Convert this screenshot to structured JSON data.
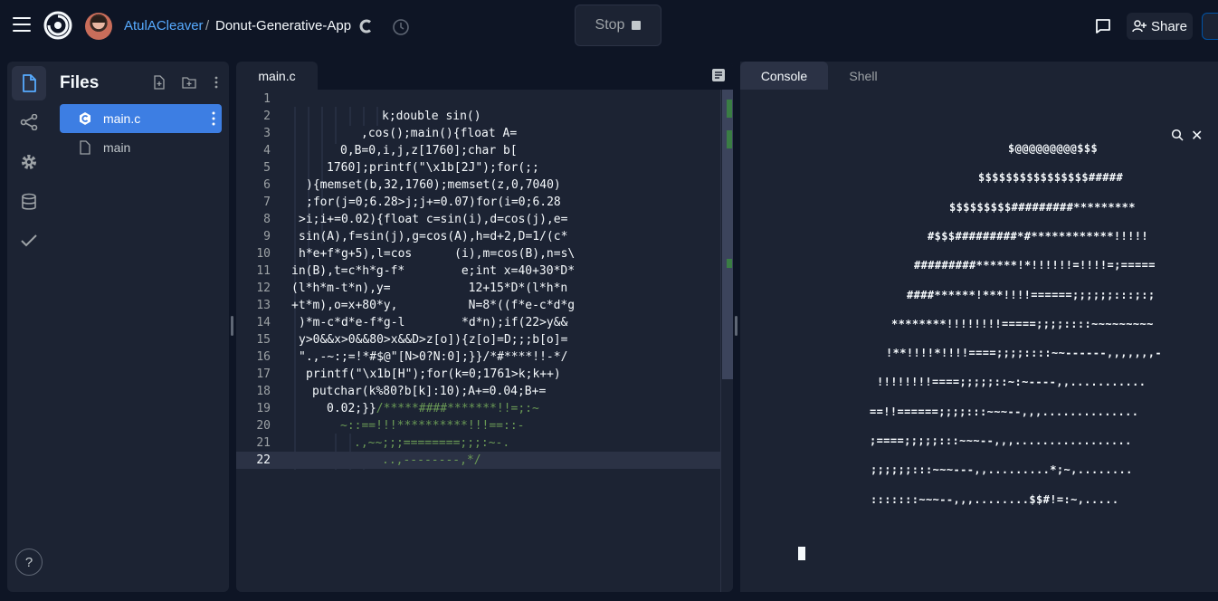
{
  "header": {
    "owner": "AtulACleaver",
    "separator": "/",
    "repl_name": "Donut-Generative-App",
    "stop_label": "Stop",
    "share_label": "Share"
  },
  "files_panel": {
    "title": "Files",
    "items": [
      {
        "name": "main.c",
        "selected": true
      },
      {
        "name": "main",
        "selected": false
      }
    ]
  },
  "editor": {
    "tab_label": "main.c",
    "current_line": 22,
    "lines": [
      {
        "n": "1",
        "text": ""
      },
      {
        "n": "2",
        "text": "k;double sin()"
      },
      {
        "n": "3",
        "text": ",cos();main(){float A="
      },
      {
        "n": "4",
        "text": "0,B=0,i,j,z[1760];char b["
      },
      {
        "n": "5",
        "text": "1760];printf(\"\\x1b[2J\");for(;;"
      },
      {
        "n": "6",
        "text": "){memset(b,32,1760);memset(z,0,7040)"
      },
      {
        "n": "7",
        "text": ";for(j=0;6.28>j;j+=0.07)for(i=0;6.28"
      },
      {
        "n": "8",
        "text": ">i;i+=0.02){float c=sin(i),d=cos(j),e="
      },
      {
        "n": "9",
        "text": "sin(A),f=sin(j),g=cos(A),h=d+2,D=1/(c*"
      },
      {
        "n": "10",
        "text": "h*e+f*g+5),l=cos      (i),m=cos(B),n=s\\"
      },
      {
        "n": "11",
        "text": "in(B),t=c*h*g-f*        e;int x=40+30*D*"
      },
      {
        "n": "12",
        "text": "(l*h*m-t*n),y=           12+15*D*(l*h*n"
      },
      {
        "n": "13",
        "text": "+t*m),o=x+80*y,          N=8*((f*e-c*d*g"
      },
      {
        "n": "14",
        "text": ")*m-c*d*e-f*g-l        *d*n);if(22>y&&"
      },
      {
        "n": "15",
        "text": "y>0&&x>0&&80>x&&D>z[o]){z[o]=D;;;b[o]="
      },
      {
        "n": "16",
        "text": "\".,-~:;=!*#$@\"[N>0?N:0];}}/*#****!!-*/"
      },
      {
        "n": "17",
        "text": "printf(\"\\x1b[H\");for(k=0;1761>k;k++)"
      },
      {
        "n": "18",
        "text": "putchar(k%80?b[k]:10);A+=0.04;B+="
      },
      {
        "n": "19",
        "text": "0.02;}}/*****####*******!!=;:~"
      },
      {
        "n": "20",
        "text": "~::==!!!**********!!!==::-"
      },
      {
        "n": "21",
        "text": ".,~~;;;========;;;:~-."
      },
      {
        "n": "22",
        "text": "..,--------,*/"
      }
    ]
  },
  "console": {
    "tab_console": "Console",
    "tab_shell": "Shell",
    "output": [
      "$@@@@@@@@@$$$",
      "$$$$$$$$$$$$$$$$#####",
      "$$$$$$$$$#########*********",
      "#$$$#########*#************!!!!!",
      "#########******!*!!!!!!=!!!!=;=====",
      "####******!***!!!!======;;;;;;:::;:;",
      "********!!!!!!!!=====;;;;::::~~~~~~~~~",
      "!**!!!!*!!!!====;;;;::::~~------,,,,,,,-",
      "!!!!!!!!====;;;;;::~:~----,,...........",
      "==!!======;;;;:::~~~--,,,..............",
      ";====;;;;;:::~~~--,,,.................",
      ";;;;;;:::~~~---,,.........*;~,........",
      ":::::::~~~--,,,........$$#!=:~,....."
    ]
  },
  "colors": {
    "background": "#0e1525",
    "panel": "#1c2333",
    "accent": "#3d7ee3",
    "link": "#57abff"
  }
}
